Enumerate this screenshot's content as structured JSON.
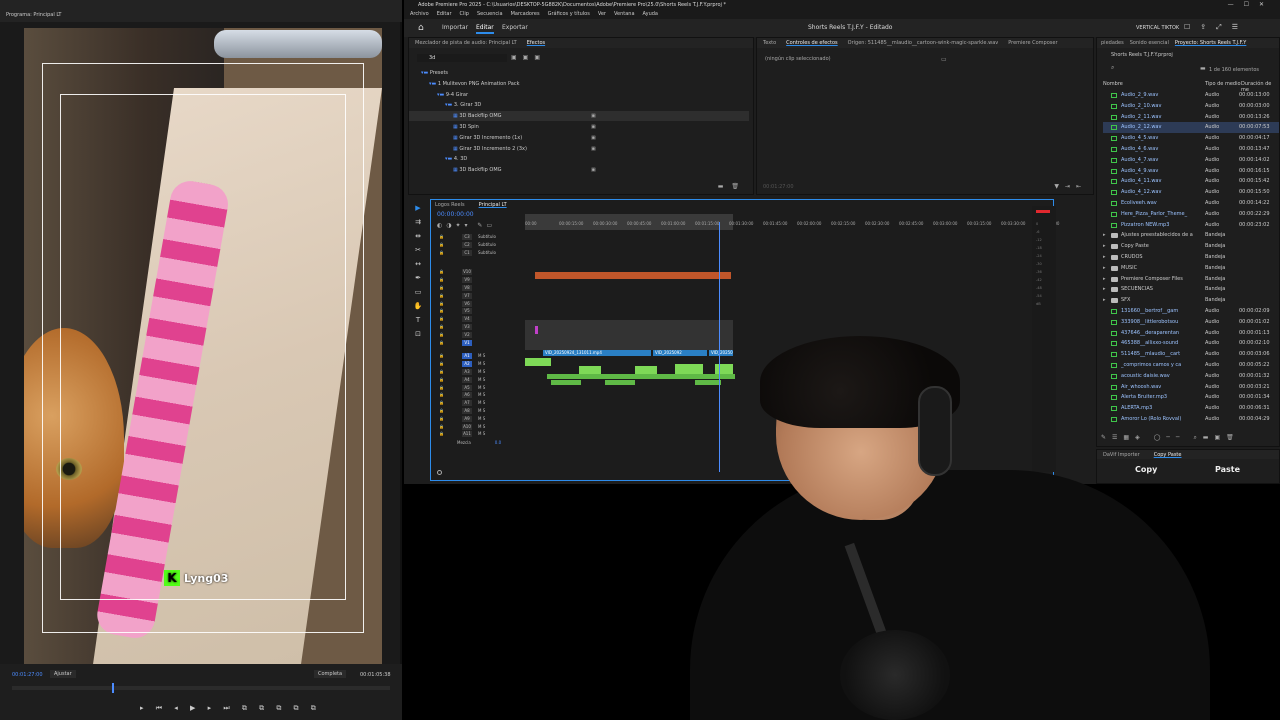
{
  "left_monitor": {
    "tab_label": "Programa: Principal LT",
    "tag_text": "Lyng03",
    "tag_letter": "K",
    "timecode_start": "00:01:27:00",
    "fit_label": "Ajustar",
    "full_label": "Completa",
    "timecode_end": "00:01:05:38",
    "transport_icons": "▸ ⏮ ◂ ▶ ▸ ⏭ ⧉ ⧉ ⧉ ⧉ ⧉"
  },
  "window": {
    "title": "Adobe Premiere Pro 2025 - C:\\Usuarios\\DESKTOP-5G882K\\Documentos\\Adobe\\Premiere Pro\\25.0\\Shorts Reels T.J.F.Y.prproj *",
    "menu": [
      "Archivo",
      "Editar",
      "Clip",
      "Secuencia",
      "Marcadores",
      "Gráficos y títulos",
      "Ver",
      "Ventana",
      "Ayuda"
    ],
    "workspace_tabs": [
      "Importar",
      "Editar",
      "Exportar"
    ],
    "active_workspace": "Editar",
    "project_title": "Shorts Reels T.J.F.Y - Editado",
    "vertical_label": "VERTICAL TIKTOK"
  },
  "effects_panel": {
    "tabs": [
      "Mezclador de pista de audio: Principal LT",
      "Efectos"
    ],
    "active_tab": "Efectos",
    "search_value": "3d",
    "tree": [
      {
        "label": "Presets",
        "indent": 0,
        "badge": ""
      },
      {
        "label": "1 Mulitevon PNG Animation Pack",
        "indent": 1,
        "badge": ""
      },
      {
        "label": "9-4 Girar",
        "indent": 2,
        "badge": ""
      },
      {
        "label": "3. Girar 3D",
        "indent": 3,
        "badge": ""
      },
      {
        "label": "3D Backflip OMG",
        "indent": 4,
        "badge": "▣",
        "selected": true
      },
      {
        "label": "3D Spin",
        "indent": 4,
        "badge": "▣"
      },
      {
        "label": "Girar 3D Incremento (1x)",
        "indent": 4,
        "badge": "▣"
      },
      {
        "label": "Girar 3D Incremento 2 (3x)",
        "indent": 4,
        "badge": "▣"
      },
      {
        "label": "4. 3D",
        "indent": 3,
        "badge": ""
      },
      {
        "label": "3D Backflip OMG",
        "indent": 4,
        "badge": "▣"
      }
    ]
  },
  "effect_controls": {
    "tabs": [
      "Texto",
      "Controles de efectos",
      "Origen: 511485__mlaudio__cartoon-wink-magic-sparkle.wav",
      "Premiere Composer"
    ],
    "active_tab": "Controles de efectos",
    "empty_message": "(ningún clip seleccionado)",
    "footer_timecode": "00:01:27:00"
  },
  "project_panel": {
    "tabs": [
      "piedades",
      "Sonido esencial",
      "Proyecto: Shorts Reels T.J.F.Y"
    ],
    "active_tab": "Proyecto: Shorts Reels T.J.F.Y",
    "project_file": "Shorts Reels T.J.F.Y.prproj",
    "item_count": "1 de 160 elementos",
    "columns": [
      "Nombre",
      "Tipo de medio",
      "Duración de me"
    ],
    "rows": [
      {
        "name": "Audio_2_9.wav",
        "type": "Audio",
        "duration": "00:00:13:00",
        "kind": "audio"
      },
      {
        "name": "Audio_2_10.wav",
        "type": "Audio",
        "duration": "00:00:03:00",
        "kind": "audio"
      },
      {
        "name": "Audio_2_11.wav",
        "type": "Audio",
        "duration": "00:00:13:26",
        "kind": "audio"
      },
      {
        "name": "Audio_2_12.wav",
        "type": "Audio",
        "duration": "00:00:07:53",
        "kind": "audio",
        "selected": true
      },
      {
        "name": "Audio_4_5.wav",
        "type": "Audio",
        "duration": "00:00:04:17",
        "kind": "audio"
      },
      {
        "name": "Audio_4_6.wav",
        "type": "Audio",
        "duration": "00:00:13:47",
        "kind": "audio"
      },
      {
        "name": "Audio_4_7.wav",
        "type": "Audio",
        "duration": "00:00:14:02",
        "kind": "audio"
      },
      {
        "name": "Audio_4_9.wav",
        "type": "Audio",
        "duration": "00:00:16:15",
        "kind": "audio"
      },
      {
        "name": "Audio_4_11.wav",
        "type": "Audio",
        "duration": "00:00:15:42",
        "kind": "audio"
      },
      {
        "name": "Audio_4_12.wav",
        "type": "Audio",
        "duration": "00:00:15:50",
        "kind": "audio"
      },
      {
        "name": "Ecoliveeh.wav",
        "type": "Audio",
        "duration": "00:00:14:22",
        "kind": "audio"
      },
      {
        "name": "Here_Pizza_Parlor_Theme_",
        "type": "Audio",
        "duration": "00:00:22:29",
        "kind": "audio"
      },
      {
        "name": "Pizzatron NEW.mp3",
        "type": "Audio",
        "duration": "00:00:23:02",
        "kind": "audio"
      },
      {
        "name": "Ajustes preestablecidos de a",
        "type": "Bandeja",
        "duration": "",
        "kind": "bin"
      },
      {
        "name": "Copy Paste",
        "type": "Bandeja",
        "duration": "",
        "kind": "bin"
      },
      {
        "name": "CRUDOS",
        "type": "Bandeja",
        "duration": "",
        "kind": "bin"
      },
      {
        "name": "MUSIC",
        "type": "Bandeja",
        "duration": "",
        "kind": "bin"
      },
      {
        "name": "Premiere Composer Files",
        "type": "Bandeja",
        "duration": "",
        "kind": "bin"
      },
      {
        "name": "SECUENCIAS",
        "type": "Bandeja",
        "duration": "",
        "kind": "bin"
      },
      {
        "name": "SFX",
        "type": "Bandeja",
        "duration": "",
        "kind": "bin"
      },
      {
        "name": "131660__bertrof__gam",
        "type": "Audio",
        "duration": "00:00:02:09",
        "kind": "audio"
      },
      {
        "name": "333908__littlerobotsou",
        "type": "Audio",
        "duration": "00:00:01:02",
        "kind": "audio"
      },
      {
        "name": "437646__deraparentan",
        "type": "Audio",
        "duration": "00:00:01:13",
        "kind": "audio"
      },
      {
        "name": "465388__allixxo-sound",
        "type": "Audio",
        "duration": "00:00:02:10",
        "kind": "audio"
      },
      {
        "name": "511485__mlaudio__cart",
        "type": "Audio",
        "duration": "00:00:03:06",
        "kind": "audio"
      },
      {
        "name": "_comprimos camos y ca",
        "type": "Audio",
        "duration": "00:00:05:22",
        "kind": "audio"
      },
      {
        "name": "acoustic daisie.wav",
        "type": "Audio",
        "duration": "00:00:01:32",
        "kind": "audio"
      },
      {
        "name": "Air_whoosh.wav",
        "type": "Audio",
        "duration": "00:00:03:21",
        "kind": "audio"
      },
      {
        "name": "Alerta Bruiter.mp3",
        "type": "Audio",
        "duration": "00:00:01:34",
        "kind": "audio"
      },
      {
        "name": "ALERTA.mp3",
        "type": "Audio",
        "duration": "00:00:06:31",
        "kind": "audio"
      },
      {
        "name": "Amoror Lo (Rolo Rovval)",
        "type": "Audio",
        "duration": "00:00:04:29",
        "kind": "audio"
      }
    ]
  },
  "copypaste_panel": {
    "tabs": [
      "DaVif Importer",
      "Copy Paste"
    ],
    "active_tab": "Copy Paste",
    "copy_label": "Copy",
    "paste_label": "Paste"
  },
  "timeline": {
    "tabs": [
      "Logos Reels",
      "Principal LT"
    ],
    "active_tab": "Principal LT",
    "timecode": "00:00:00:00",
    "ruler_ticks": [
      "00:00",
      "00:00:15:00",
      "00:00:30:00",
      "00:00:45:00",
      "00:01:00:00",
      "00:01:15:00",
      "00:01:30:00",
      "00:01:45:00",
      "00:02:00:00",
      "00:02:15:00",
      "00:02:30:00",
      "00:02:45:00",
      "00:03:00:00",
      "00:03:15:00",
      "00:03:30:00",
      "00:03:45:00"
    ],
    "tracks": [
      {
        "id": "C3",
        "name": "Subtítulo"
      },
      {
        "id": "C2",
        "name": "Subtítulo"
      },
      {
        "id": "C1",
        "name": "Subtítulo"
      },
      {
        "id": "V10",
        "name": ""
      },
      {
        "id": "V9",
        "name": ""
      },
      {
        "id": "V8",
        "name": ""
      },
      {
        "id": "V7",
        "name": ""
      },
      {
        "id": "V6",
        "name": ""
      },
      {
        "id": "V5",
        "name": ""
      },
      {
        "id": "V4",
        "name": ""
      },
      {
        "id": "V3",
        "name": ""
      },
      {
        "id": "V2",
        "name": ""
      },
      {
        "id": "V1",
        "name": ""
      },
      {
        "id": "A1",
        "name": "M S"
      },
      {
        "id": "A2",
        "name": "M S"
      },
      {
        "id": "A3",
        "name": "M S"
      },
      {
        "id": "A4",
        "name": "M S"
      },
      {
        "id": "A5",
        "name": "M S"
      },
      {
        "id": "A6",
        "name": "M S"
      },
      {
        "id": "A7",
        "name": "M S"
      },
      {
        "id": "A8",
        "name": "M S"
      },
      {
        "id": "A9",
        "name": "M S"
      },
      {
        "id": "A10",
        "name": "M S"
      },
      {
        "id": "A11",
        "name": "M S"
      }
    ],
    "mix_label": "Mezcla",
    "mix_value": "0.0",
    "clip_labels": [
      "VID_20250924_131011.mp4",
      "VID_2025092",
      "VID_20250924..."
    ],
    "meter_scale": [
      "0",
      "-6",
      "-12",
      "-18",
      "-24",
      "-30",
      "-36",
      "-42",
      "-48",
      "-54",
      "dB"
    ]
  }
}
